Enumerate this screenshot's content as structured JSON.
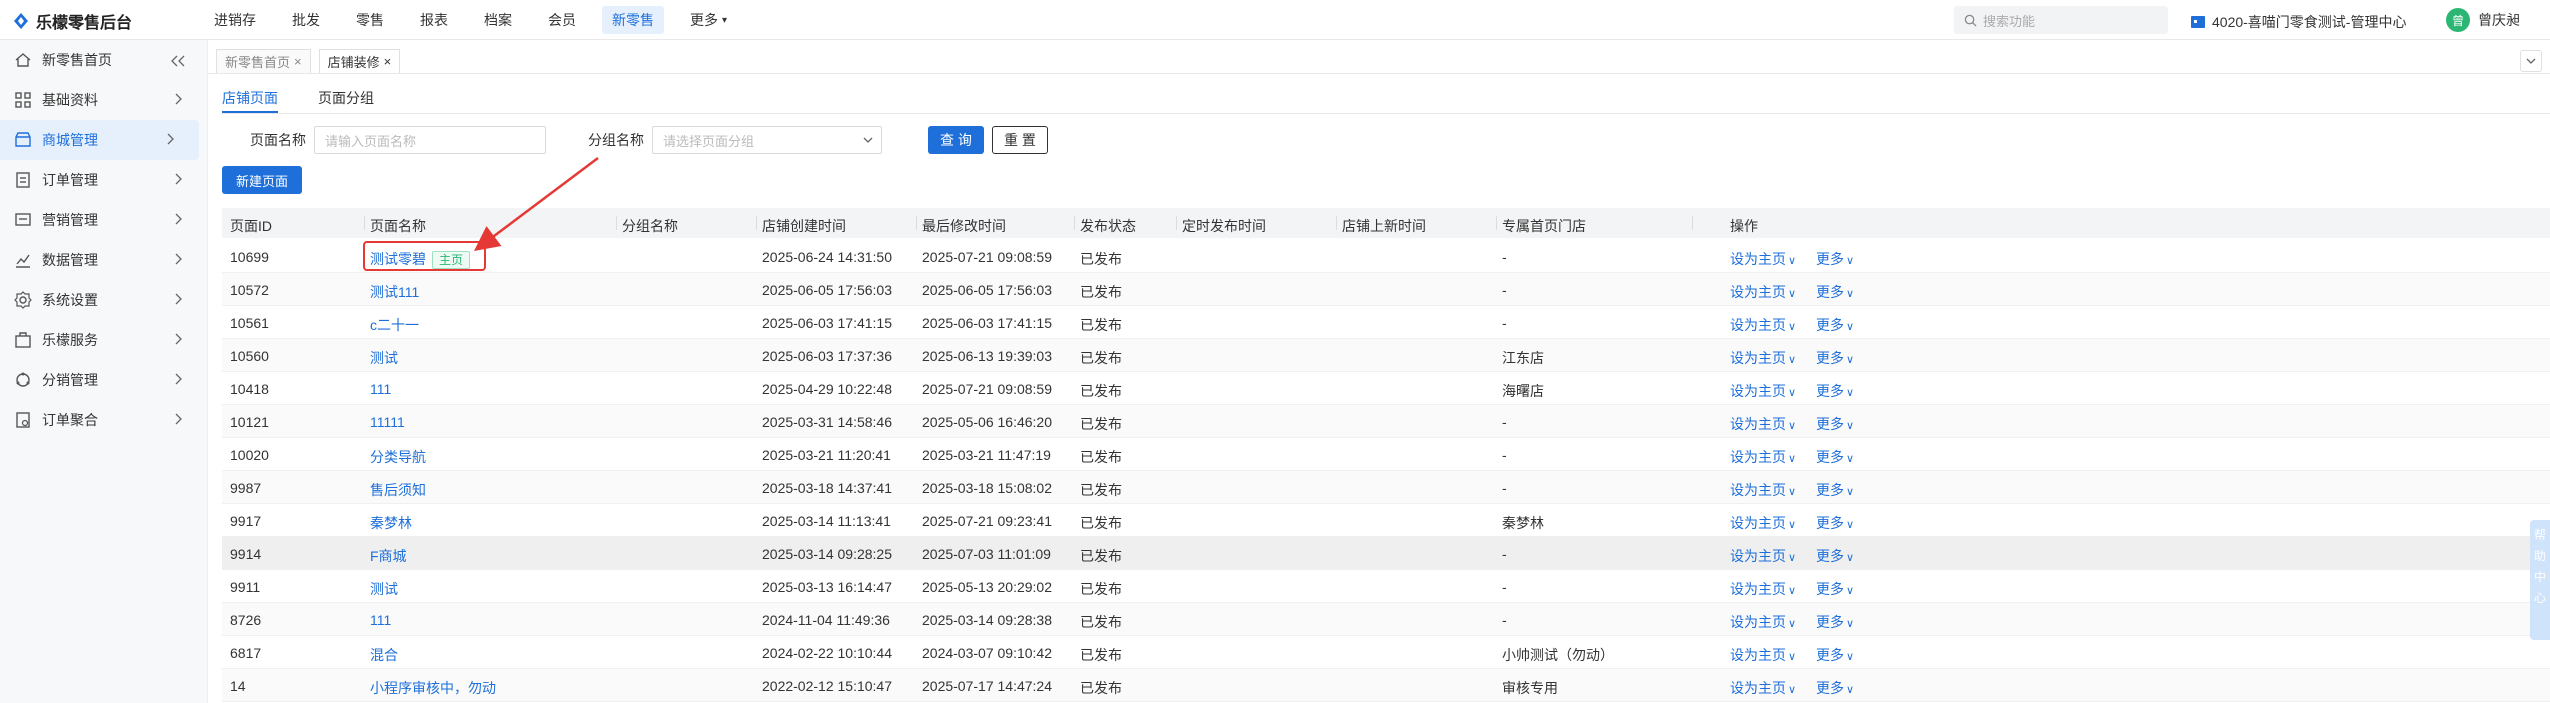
{
  "app": {
    "title": "乐檬零售后台"
  },
  "topnav": [
    "进销存",
    "批发",
    "零售",
    "报表",
    "档案",
    "会员",
    "新零售",
    "更多"
  ],
  "topnav_active": 6,
  "search": {
    "placeholder": "搜索功能"
  },
  "store": "4020-喜喵门零食测试-管理中心",
  "user": {
    "name": "曾庆昶",
    "avatar_char": "曾"
  },
  "sidebar": {
    "items": [
      {
        "label": "新零售首页",
        "icon": "home-icon"
      },
      {
        "label": "基础资料",
        "icon": "grid-icon"
      },
      {
        "label": "商城管理",
        "icon": "store-icon"
      },
      {
        "label": "订单管理",
        "icon": "order-icon"
      },
      {
        "label": "营销管理",
        "icon": "marketing-icon"
      },
      {
        "label": "数据管理",
        "icon": "chart-icon"
      },
      {
        "label": "系统设置",
        "icon": "gear-icon"
      },
      {
        "label": "乐檬服务",
        "icon": "service-icon"
      },
      {
        "label": "分销管理",
        "icon": "distribution-icon"
      },
      {
        "label": "订单聚合",
        "icon": "aggregate-icon"
      }
    ],
    "active": 2
  },
  "tabs": [
    {
      "label": "新零售首页"
    },
    {
      "label": "店铺装修"
    }
  ],
  "subtabs": [
    "店铺页面",
    "页面分组"
  ],
  "filters": {
    "name_label": "页面名称",
    "name_placeholder": "请输入页面名称",
    "group_label": "分组名称",
    "group_placeholder": "请选择页面分组",
    "query": "查 询",
    "reset": "重 置"
  },
  "new_page": "新建页面",
  "table": {
    "headers": [
      "页面ID",
      "页面名称",
      "分组名称",
      "店铺创建时间",
      "最后修改时间",
      "发布状态",
      "定时发布时间",
      "店铺上新时间",
      "专属首页门店",
      "操作"
    ],
    "homepage_badge": "主页",
    "op_set_home": "设为主页",
    "op_more": "更多",
    "rows": [
      {
        "id": "10699",
        "name": "测试零碧",
        "created": "2025-06-24 14:31:50",
        "modified": "2025-07-21 09:08:59",
        "status": "已发布",
        "store": "-",
        "home": true
      },
      {
        "id": "10572",
        "name": "测试111",
        "created": "2025-06-05 17:56:03",
        "modified": "2025-06-05 17:56:03",
        "status": "已发布",
        "store": "-"
      },
      {
        "id": "10561",
        "name": "c二十一",
        "created": "2025-06-03 17:41:15",
        "modified": "2025-06-03 17:41:15",
        "status": "已发布",
        "store": "-"
      },
      {
        "id": "10560",
        "name": "测试",
        "created": "2025-06-03 17:37:36",
        "modified": "2025-06-13 19:39:03",
        "status": "已发布",
        "store": "江东店"
      },
      {
        "id": "10418",
        "name": "111",
        "created": "2025-04-29 10:22:48",
        "modified": "2025-07-21 09:08:59",
        "status": "已发布",
        "store": "海曙店"
      },
      {
        "id": "10121",
        "name": "11111",
        "created": "2025-03-31 14:58:46",
        "modified": "2025-05-06 16:46:20",
        "status": "已发布",
        "store": "-"
      },
      {
        "id": "10020",
        "name": "分类导航",
        "created": "2025-03-21 11:20:41",
        "modified": "2025-03-21 11:47:19",
        "status": "已发布",
        "store": "-"
      },
      {
        "id": "9987",
        "name": "售后须知",
        "created": "2025-03-18 14:37:41",
        "modified": "2025-03-18 15:08:02",
        "status": "已发布",
        "store": "-"
      },
      {
        "id": "9917",
        "name": "秦梦林",
        "created": "2025-03-14 11:13:41",
        "modified": "2025-07-21 09:23:41",
        "status": "已发布",
        "store": "秦梦林"
      },
      {
        "id": "9914",
        "name": "F商城",
        "created": "2025-03-14 09:28:25",
        "modified": "2025-07-03 11:01:09",
        "status": "已发布",
        "store": "-"
      },
      {
        "id": "9911",
        "name": "测试",
        "created": "2025-03-13 16:14:47",
        "modified": "2025-05-13 20:29:02",
        "status": "已发布",
        "store": "-"
      },
      {
        "id": "8726",
        "name": "111",
        "created": "2024-11-04 11:49:36",
        "modified": "2025-03-14 09:28:38",
        "status": "已发布",
        "store": "-"
      },
      {
        "id": "6817",
        "name": "混合",
        "created": "2024-02-22 10:10:44",
        "modified": "2024-03-07 09:10:42",
        "status": "已发布",
        "store": "小帅测试（勿动）"
      },
      {
        "id": "14",
        "name": "小程序审核中，勿动",
        "created": "2022-02-12 15:10:47",
        "modified": "2025-07-17 14:47:24",
        "status": "已发布",
        "store": "审核专用"
      }
    ]
  },
  "help": [
    "帮",
    "助",
    "中",
    "心"
  ],
  "colors": {
    "primary": "#1e6fd9",
    "highlight": "#e53935",
    "badge": "#2bb673"
  }
}
